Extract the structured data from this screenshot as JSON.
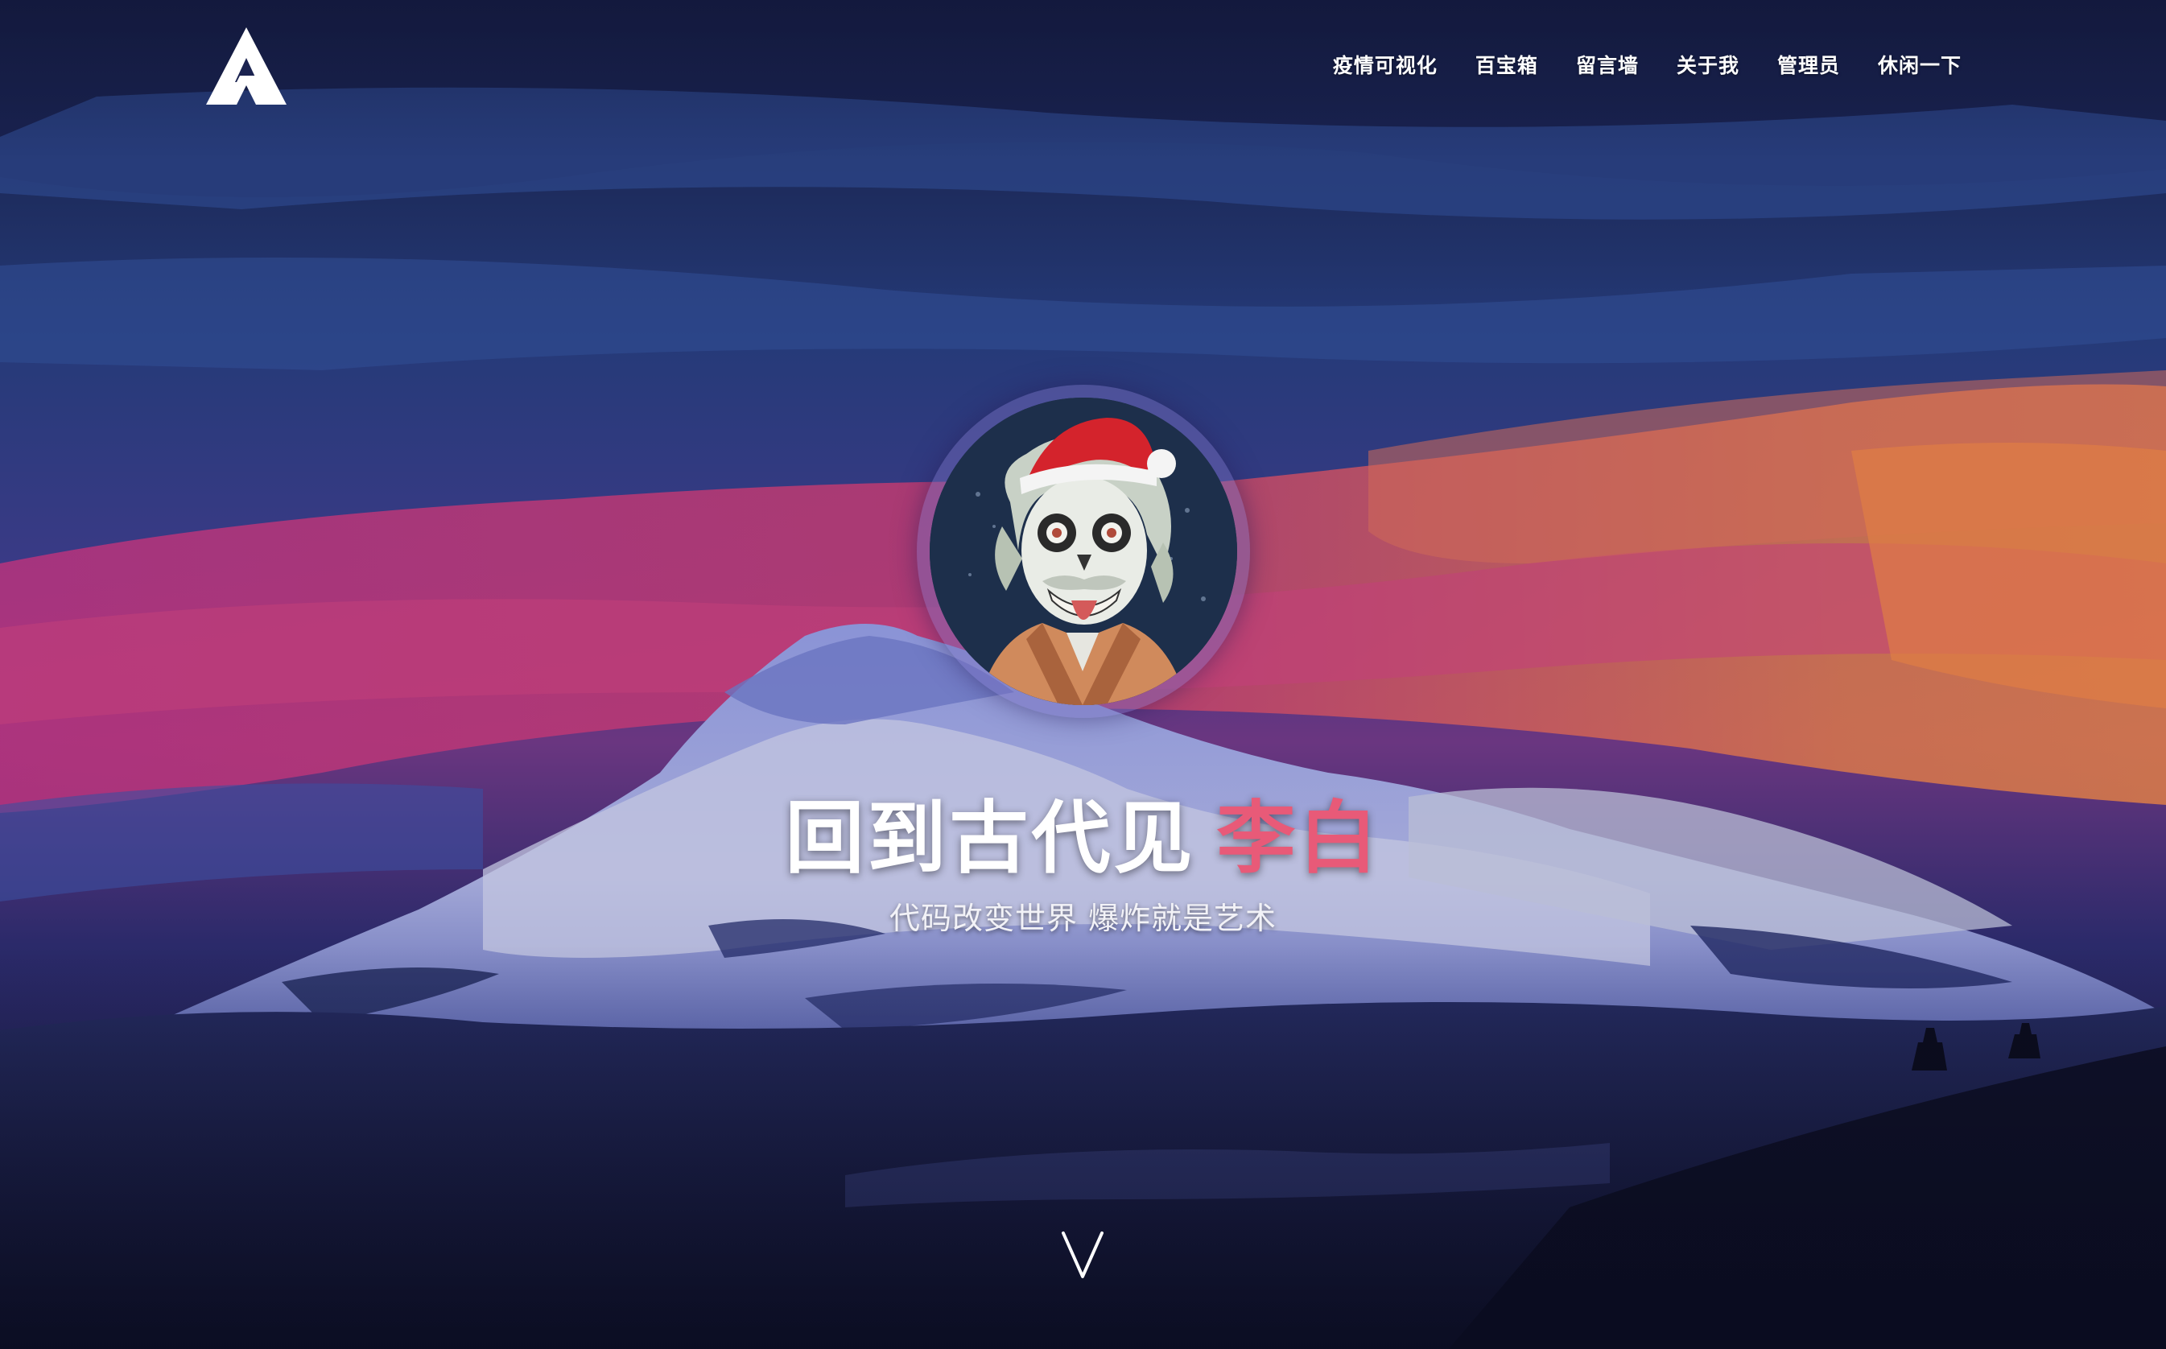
{
  "header": {
    "logo_icon": "triangle-a-logo",
    "nav": [
      {
        "label": "疫情可视化"
      },
      {
        "label": "百宝箱"
      },
      {
        "label": "留言墙"
      },
      {
        "label": "关于我"
      },
      {
        "label": "管理员"
      },
      {
        "label": "休闲一下"
      }
    ]
  },
  "hero": {
    "avatar_icon": "skull-santa-avatar",
    "title_main": "回到古代见",
    "title_accent": "李白",
    "subtitle": "代码改变世界 爆炸就是艺术",
    "scroll_icon": "chevron-down-icon"
  },
  "colors": {
    "accent": "#e85a78",
    "text": "#ffffff",
    "sky_dark": "#1b2350",
    "sky_magenta": "#b0357f",
    "sky_orange": "#d9774a"
  }
}
